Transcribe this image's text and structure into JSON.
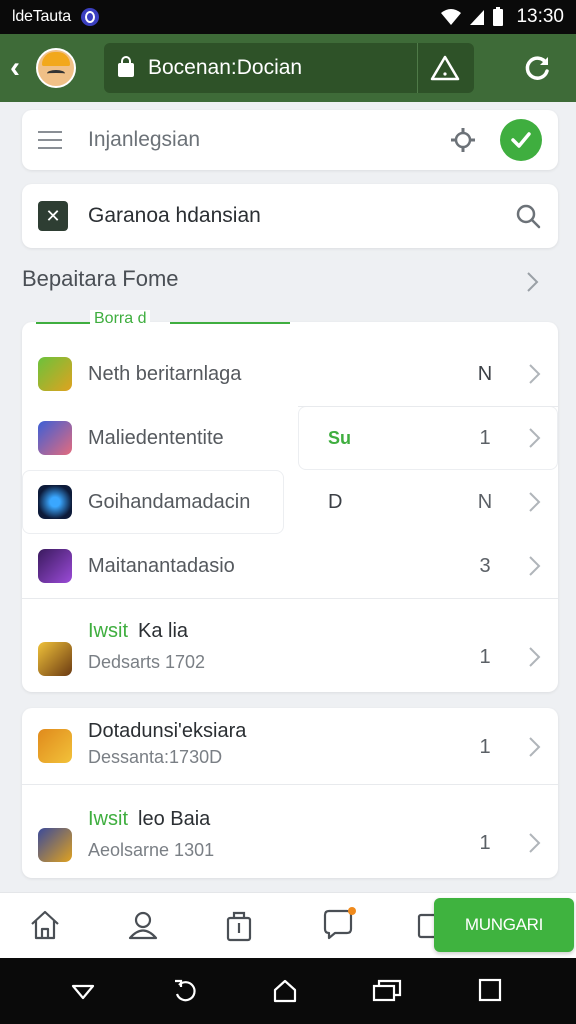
{
  "status_bar": {
    "carrier": "ldeTauta",
    "time": "13:30"
  },
  "app_bar": {
    "address_text": "Bocenan:Docian"
  },
  "top_search": {
    "text": "Injanlegsian"
  },
  "query": {
    "text": "Garanoa hdansian"
  },
  "section": {
    "title": "Bepaitara Fome"
  },
  "list1": {
    "tab_label": "Borra d",
    "rows": [
      {
        "name": "Neth beritarnlaga",
        "mid": "",
        "value": "N"
      },
      {
        "name": "Maliedententite",
        "mid": "Su",
        "value": "1"
      },
      {
        "name": "Goihandamadacin",
        "mid": "D",
        "value": "N"
      },
      {
        "name": "Maitanantadasio",
        "mid": "",
        "value": "3"
      },
      {
        "badge": "Iwsit",
        "title": "Ka lia",
        "sub": "Dedsarts 1702",
        "value": "1"
      }
    ]
  },
  "list2": {
    "rows": [
      {
        "title": "Dotadunsi'eksiara",
        "sub": "Dessanta:1730D",
        "value": "1"
      },
      {
        "badge": "Iwsit",
        "title": "leo Baia",
        "sub": "Aeolsarne 1301",
        "value": "1"
      }
    ]
  },
  "bottom_nav": {
    "primary_button": "MUNGARI"
  },
  "colors": {
    "app_bar": "#3e6b38",
    "accent_green": "#3fae3f",
    "background": "#eef0f3"
  }
}
